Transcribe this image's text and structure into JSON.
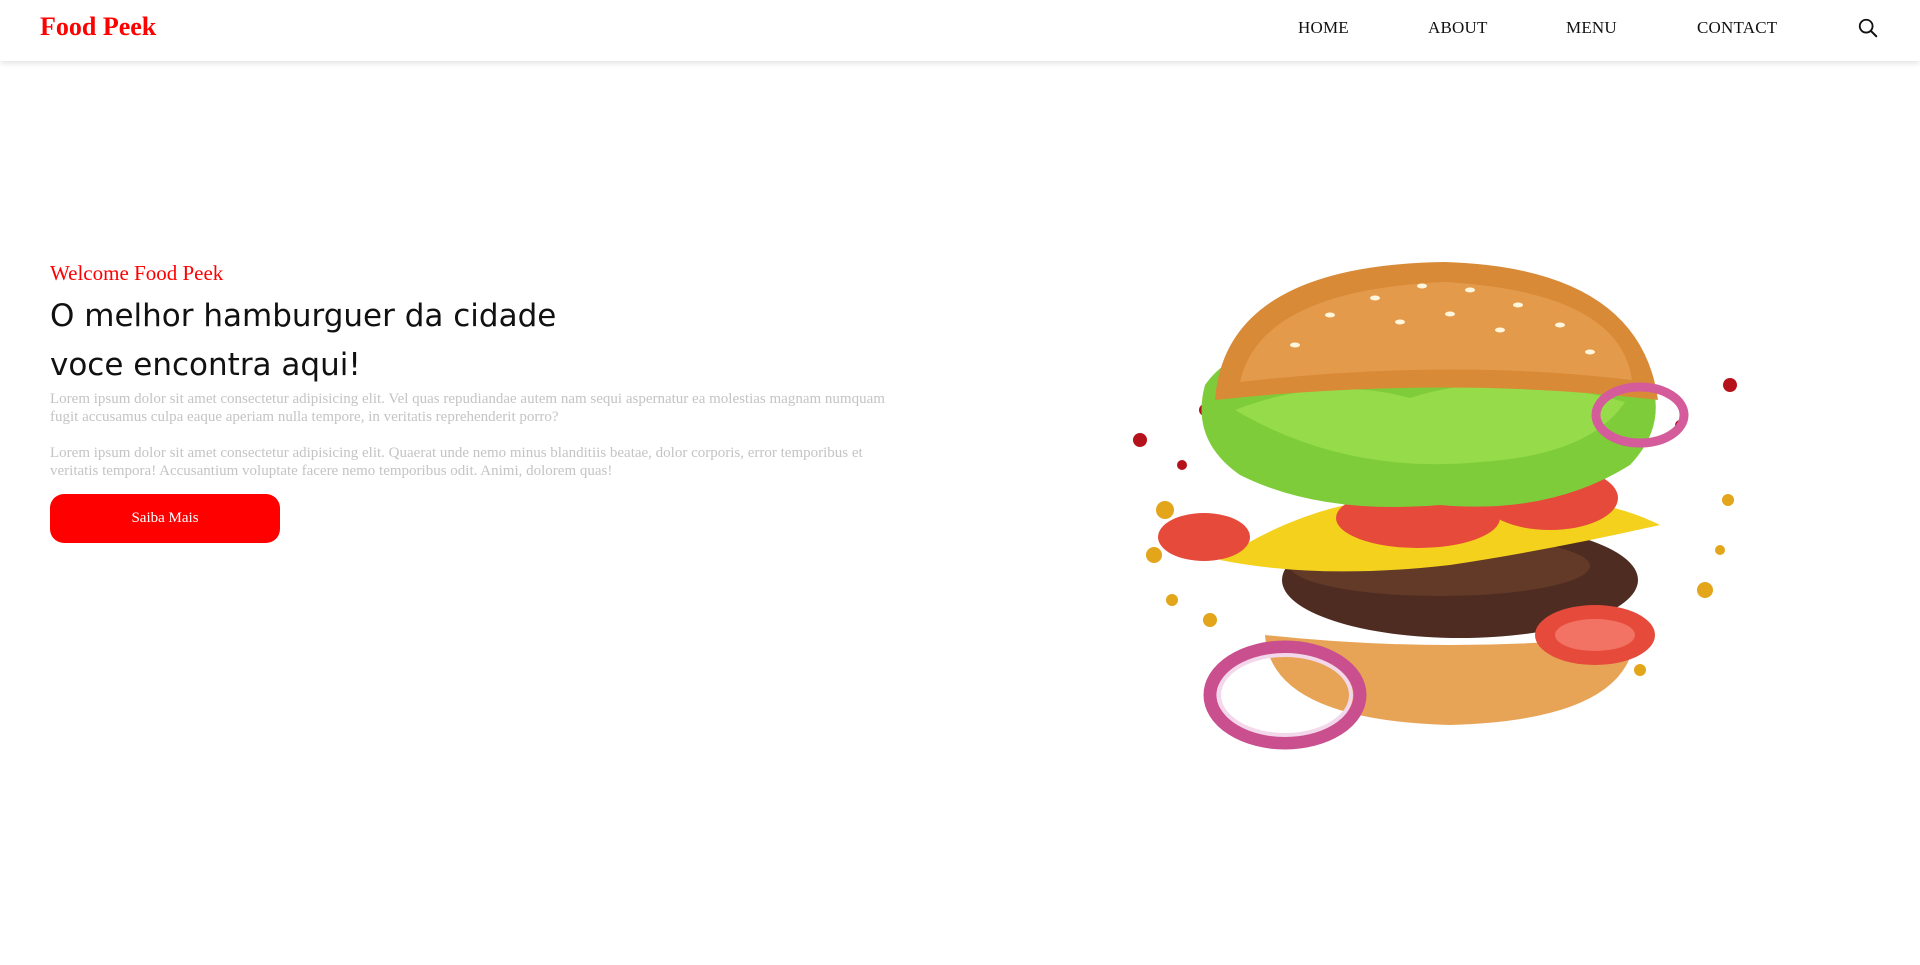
{
  "brand": {
    "name": "Food Peek",
    "color": "#ff0000"
  },
  "nav": {
    "items": [
      {
        "label": "HOME"
      },
      {
        "label": "ABOUT"
      },
      {
        "label": "MENU"
      },
      {
        "label": "CONTACT"
      }
    ],
    "search_icon": "search-icon"
  },
  "hero": {
    "subtitle": "Welcome Food Peek",
    "title_line1": "O melhor hamburguer da cidade",
    "title_line2": "voce encontra aqui!",
    "paragraph1": "Lorem ipsum dolor sit amet consectetur adipisicing elit. Vel quas repudiandae autem nam sequi aspernatur ea molestias magnam numquam fugit accusamus culpa eaque aperiam nulla tempore, in veritatis reprehenderit porro?",
    "paragraph2": "Lorem ipsum dolor sit amet consectetur adipisicing elit. Quaerat unde nemo minus blanditiis beatae, dolor corporis, error temporibus et veritatis tempora! Accusantium voluptate facere nemo temporibus odit. Animi, dolorem quas!",
    "button_label": "Saiba Mais",
    "image": "flying-burger-image"
  },
  "colors": {
    "accent": "#ff0000",
    "muted_text": "#c4c4c4"
  }
}
